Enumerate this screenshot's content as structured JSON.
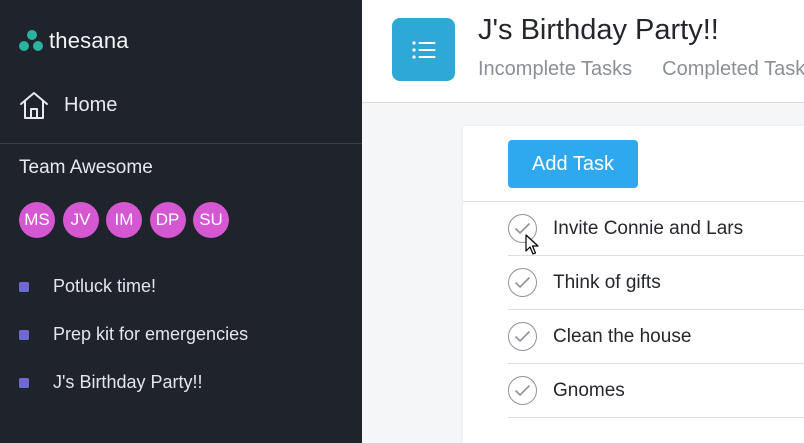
{
  "sidebar": {
    "logo_text": "thesana",
    "home_label": "Home",
    "team_name": "Team Awesome",
    "members": [
      "MS",
      "JV",
      "IM",
      "DP",
      "SU"
    ],
    "projects": [
      {
        "label": "Potluck time!"
      },
      {
        "label": "Prep kit for emergencies"
      },
      {
        "label": "J's Birthday Party!!"
      }
    ]
  },
  "header": {
    "title": "J's Birthday Party!!",
    "tabs": [
      "Incomplete Tasks",
      "Completed Tasks"
    ],
    "icon": "list-icon"
  },
  "main": {
    "add_task_label": "Add Task",
    "tasks": [
      {
        "label": "Invite Connie and Lars"
      },
      {
        "label": "Think of gifts"
      },
      {
        "label": "Clean the house"
      },
      {
        "label": "Gnomes"
      }
    ]
  },
  "colors": {
    "sidebar_bg": "#1f232b",
    "accent_blue": "#2ea8ee",
    "project_icon": "#2ea9d7",
    "avatar": "#d557d2",
    "project_dot": "#6e6ad4",
    "logo": "#2bb3a0"
  }
}
